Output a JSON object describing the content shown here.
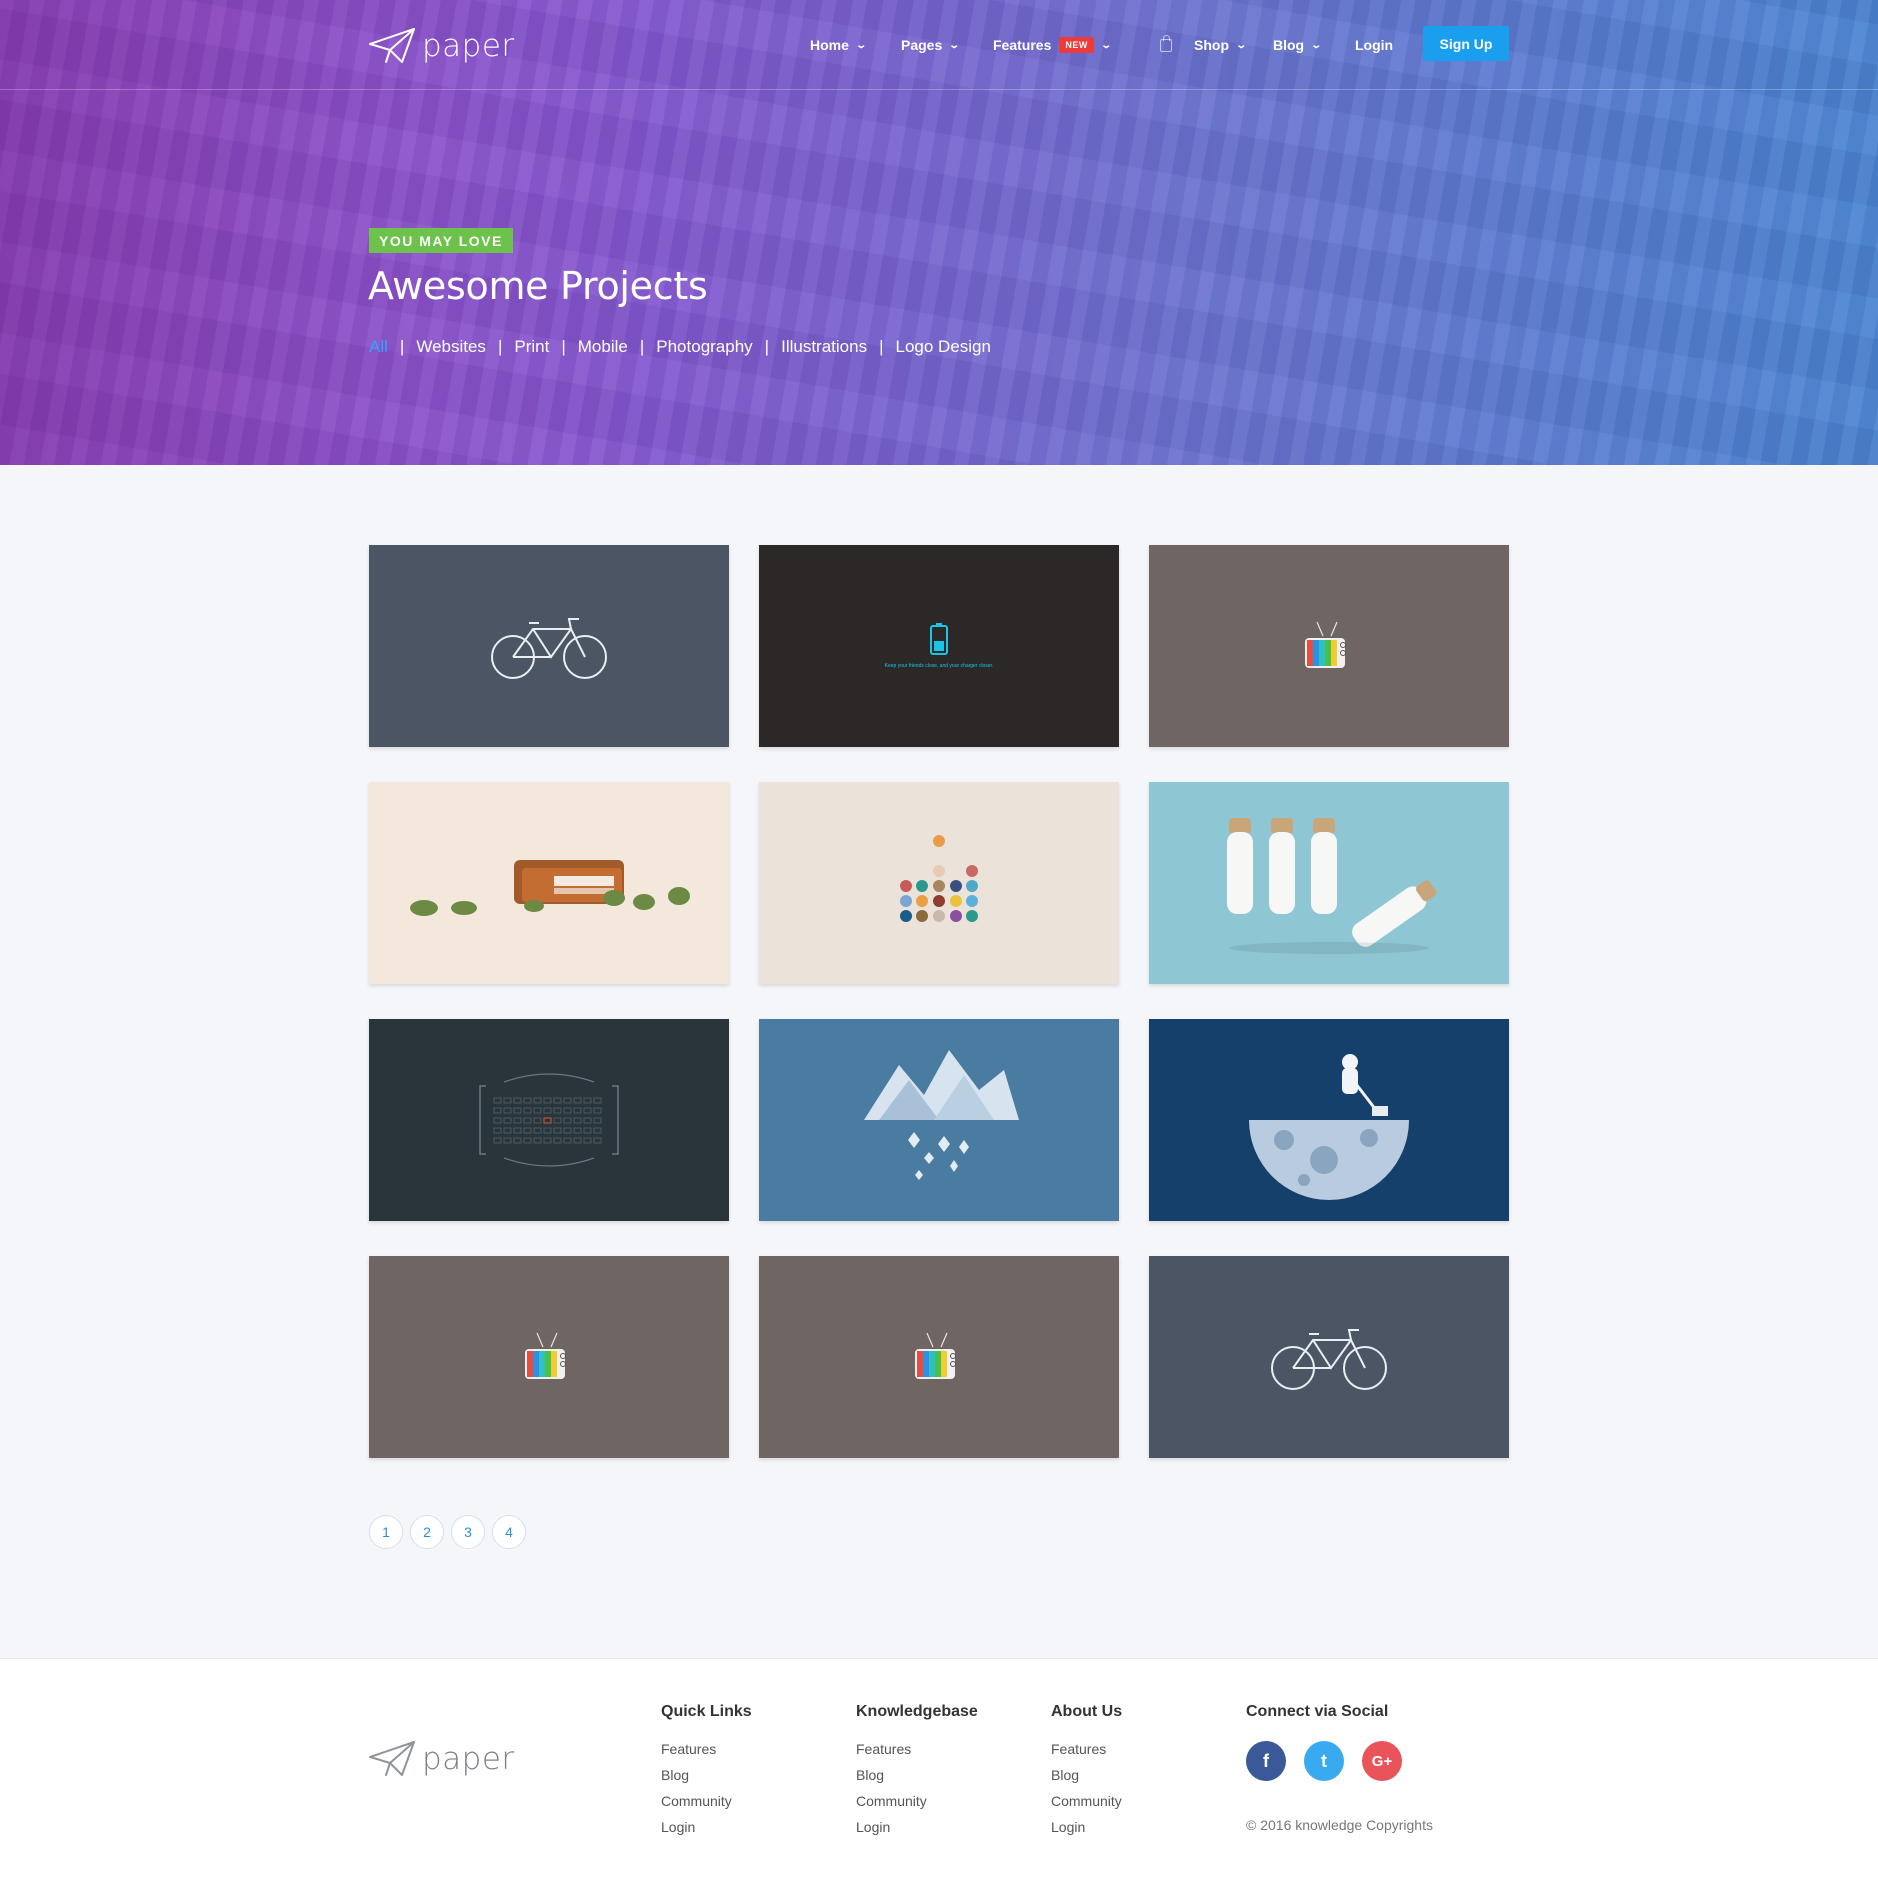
{
  "brand": {
    "name": "paper"
  },
  "nav": {
    "items": [
      {
        "label": "Home"
      },
      {
        "label": "Pages"
      },
      {
        "label": "Features",
        "badge": "NEW"
      },
      {
        "label": "Shop"
      },
      {
        "label": "Blog"
      },
      {
        "label": "Login"
      }
    ],
    "signup_label": "Sign Up"
  },
  "hero": {
    "kicker": "YOU MAY LOVE",
    "title": "Awesome Projects",
    "filters": [
      "All",
      "Websites",
      "Print",
      "Mobile",
      "Photography",
      "Illustrations",
      "Logo Design"
    ],
    "active_filter": "All"
  },
  "projects": [
    {
      "name": "bicycle",
      "bg": "#4b5563",
      "caption": ""
    },
    {
      "name": "battery",
      "bg": "#2c2828",
      "caption": "Keep your friends close, and your charger closer."
    },
    {
      "name": "retro-tv",
      "bg": "#6f6562",
      "caption": ""
    },
    {
      "name": "wallet-money",
      "bg": "#f3e8db",
      "caption": ""
    },
    {
      "name": "color-dots",
      "bg": "#ebe3da",
      "caption": ""
    },
    {
      "name": "bottles",
      "bg": "#8ec6d3",
      "caption": ""
    },
    {
      "name": "camera-focus",
      "bg": "#29343b",
      "caption": ""
    },
    {
      "name": "crystal-mountain",
      "bg": "#4a7ba0",
      "caption": ""
    },
    {
      "name": "moon-mower",
      "bg": "#15406b",
      "caption": ""
    },
    {
      "name": "retro-tv",
      "bg": "#6f6562",
      "caption": ""
    },
    {
      "name": "retro-tv",
      "bg": "#6f6562",
      "caption": ""
    },
    {
      "name": "bicycle",
      "bg": "#4b5563",
      "caption": ""
    }
  ],
  "pagination": [
    "1",
    "2",
    "3",
    "4"
  ],
  "footer": {
    "columns": [
      {
        "title": "Quick Links",
        "links": [
          "Features",
          "Blog",
          "Community",
          "Login"
        ]
      },
      {
        "title": "Knowledgebase",
        "links": [
          "Features",
          "Blog",
          "Community",
          "Login"
        ]
      },
      {
        "title": "About Us",
        "links": [
          "Features",
          "Blog",
          "Community",
          "Login"
        ]
      }
    ],
    "social": {
      "title": "Connect via Social",
      "icons": [
        {
          "name": "facebook-icon",
          "glyph": "f",
          "color": "#3b5998"
        },
        {
          "name": "twitter-icon",
          "glyph": "t",
          "color": "#3aaaf0"
        },
        {
          "name": "google-plus-icon",
          "glyph": "G+",
          "color": "#e9545a"
        }
      ]
    },
    "copyright": "© 2016 knowledge Copyrights"
  },
  "colors": {
    "accent": "#1a9fef",
    "badge": "#ec3b3b",
    "kicker": "#6cc24a",
    "hero_gradient": [
      "#9a48c6",
      "#4a84d2"
    ]
  }
}
